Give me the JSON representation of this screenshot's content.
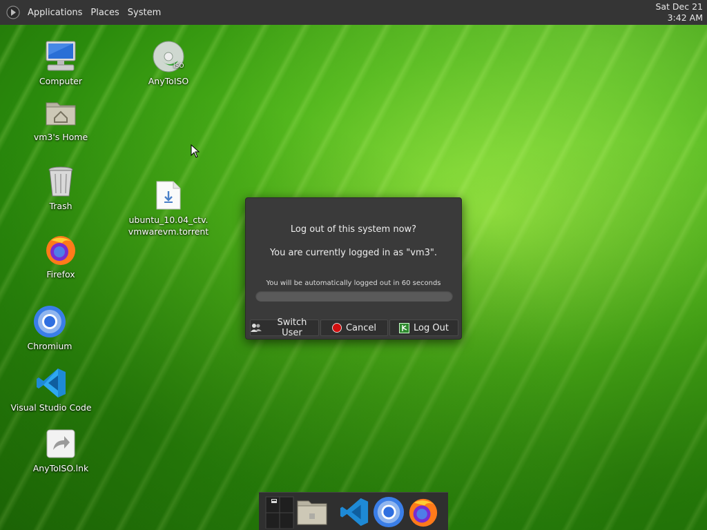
{
  "panel": {
    "menus": [
      "Applications",
      "Places",
      "System"
    ],
    "clock": {
      "date": "Sat Dec 21",
      "time": "3:42 AM"
    }
  },
  "desktop": {
    "icons": [
      {
        "id": "computer",
        "label": "Computer",
        "icon": "computer-icon"
      },
      {
        "id": "home",
        "label": "vm3's Home",
        "icon": "home-folder-icon"
      },
      {
        "id": "trash",
        "label": "Trash",
        "icon": "trash-icon"
      },
      {
        "id": "firefox",
        "label": "Firefox",
        "icon": "firefox-icon"
      },
      {
        "id": "chromium",
        "label": "Chromium",
        "icon": "chromium-icon"
      },
      {
        "id": "vscode",
        "label": "Visual Studio Code",
        "icon": "vscode-icon"
      },
      {
        "id": "anytoiso-lnk",
        "label": "AnyToISO.lnk",
        "icon": "shortcut-icon"
      },
      {
        "id": "anytoiso",
        "label": "AnyToISO",
        "icon": "iso-disc-icon"
      },
      {
        "id": "torrent",
        "label": "ubuntu_10.04_ctv.\nvmwarevm.torrent",
        "icon": "torrent-file-icon"
      }
    ]
  },
  "dialog": {
    "question": "Log out of this system now?",
    "logged_in_as": "You are currently logged in as \"vm3\".",
    "auto_logout": "You will be automatically logged out in 60 seconds",
    "progress": 0.0,
    "buttons": {
      "switch_user": "Switch User",
      "cancel": "Cancel",
      "log_out": "Log Out"
    }
  },
  "dock": {
    "items": [
      "workspace-switcher-icon",
      "files-icon",
      "vscode-icon",
      "chromium-icon",
      "firefox-icon"
    ]
  },
  "colors": {
    "panel": "#353535",
    "dialog": "#3a3a3a",
    "cancel_red": "#d01010"
  }
}
